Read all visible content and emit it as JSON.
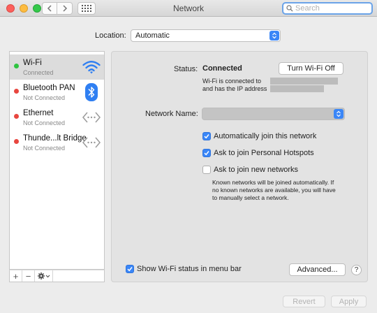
{
  "window": {
    "title": "Network",
    "search": {
      "placeholder": "Search",
      "value": ""
    }
  },
  "location": {
    "label": "Location:",
    "value": "Automatic"
  },
  "services": [
    {
      "name": "Wi-Fi",
      "status": "Connected",
      "dot_color": "#2ec440",
      "icon": "wifi-icon",
      "selected": true
    },
    {
      "name": "Bluetooth PAN",
      "status": "Not Connected",
      "dot_color": "#e8463f",
      "icon": "bluetooth-icon",
      "selected": false
    },
    {
      "name": "Ethernet",
      "status": "Not Connected",
      "dot_color": "#e8463f",
      "icon": "ethernet-icon",
      "selected": false
    },
    {
      "name": "Thunde...lt Bridge",
      "status": "Not Connected",
      "dot_color": "#e8463f",
      "icon": "thunderbolt-bridge-icon",
      "selected": false
    }
  ],
  "services_toolbar": {
    "add": "+",
    "remove": "−",
    "action": "gear-icon"
  },
  "detail": {
    "status_label": "Status:",
    "status_value": "Connected",
    "turn_off_button": "Turn Wi-Fi Off",
    "status_line1": "Wi-Fi is connected to",
    "status_line2": "and has the IP address",
    "network_name_label": "Network Name:",
    "options": [
      {
        "label": "Automatically join this network",
        "checked": true
      },
      {
        "label": "Ask to join Personal Hotspots",
        "checked": true
      },
      {
        "label": "Ask to join new networks",
        "checked": false
      }
    ],
    "help_lines": [
      "Known networks will be joined automatically. If",
      "no known networks are available, you will have",
      "to manually select a network."
    ],
    "show_status_menu": {
      "label": "Show Wi-Fi status in menu bar",
      "checked": true
    },
    "advanced_button": "Advanced...",
    "help_button": "?"
  },
  "footer": {
    "revert": "Revert",
    "apply": "Apply"
  },
  "colors": {
    "accent": "#3a86f7",
    "connected": "#2ec440",
    "disconnected": "#e8463f"
  }
}
